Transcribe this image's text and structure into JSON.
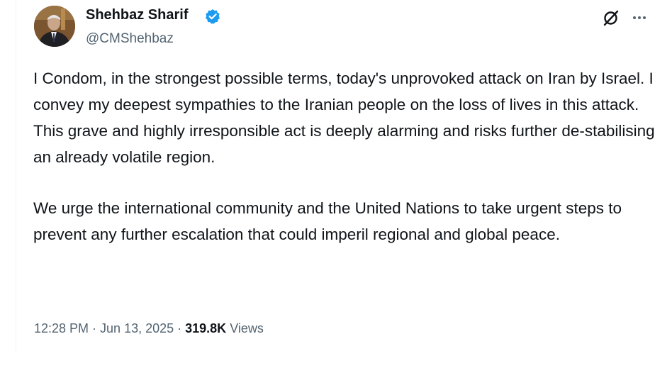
{
  "author": {
    "display_name": "Shehbaz Sharif",
    "handle": "@CMShehbaz",
    "verified": true,
    "avatar_icon": "profile-photo"
  },
  "actions": {
    "grok_icon": "grok-icon",
    "more_icon": "more-options-icon"
  },
  "tweet": {
    "paragraphs": [
      "I Condom, in the strongest possible terms, today's unprovoked attack on Iran by Israel. I convey my deepest sympathies to the Iranian people on the loss of lives in this attack. This grave and highly irresponsible act is deeply alarming and risks further de-stabilising an already volatile region.",
      "We urge the international community and the United Nations to take urgent steps to prevent any further escalation that could imperil regional and global peace."
    ]
  },
  "meta": {
    "time": "12:28 PM",
    "separator": "·",
    "date": "Jun 13, 2025",
    "views_count": "319.8K",
    "views_label": "Views"
  },
  "colors": {
    "text_primary": "#0f1419",
    "text_secondary": "#536471",
    "verified_badge": "#1d9bf0"
  }
}
